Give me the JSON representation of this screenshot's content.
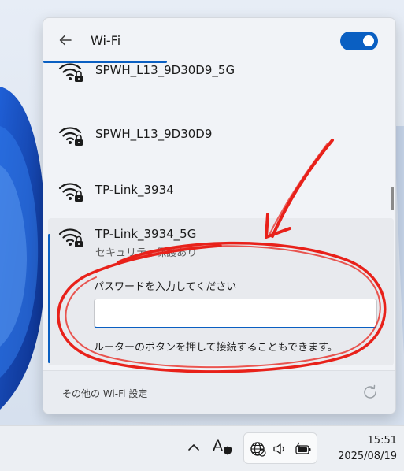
{
  "wifi_panel": {
    "title": "Wi-Fi",
    "toggle_state": "on",
    "networks": [
      {
        "name": "SPWH_L13_9D30D9_5G",
        "secured": true
      },
      {
        "name": "SPWH_L13_9D30D9",
        "secured": true
      },
      {
        "name": "TP-Link_3934",
        "secured": true
      }
    ],
    "expanded_network": {
      "name": "TP-Link_3934_5G",
      "status": "セキュリティ保護あり",
      "password_label": "パスワードを入力してください",
      "password_value": "",
      "hint": "ルーターのボタンを押して接続することもできます。"
    },
    "footer": {
      "settings_link": "その他の Wi-Fi 設定"
    }
  },
  "taskbar": {
    "ime_label": "A",
    "time": "15:51",
    "date": "2025/08/19"
  },
  "colors": {
    "accent": "#0a5fc2",
    "annotation": "#e8211a"
  }
}
